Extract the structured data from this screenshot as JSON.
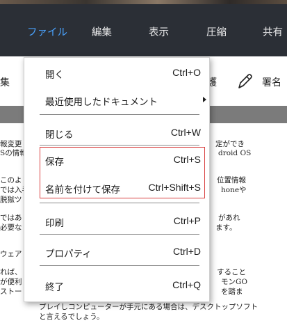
{
  "menubar": {
    "tabs": [
      {
        "label": "ファイル",
        "active": true
      },
      {
        "label": "編集"
      },
      {
        "label": "表示"
      },
      {
        "label": "圧縮"
      },
      {
        "label": "共有"
      }
    ]
  },
  "toolbar": {
    "left_label": "集",
    "protect_label": "護",
    "sign_label": "署名",
    "sign_icon": "pen-icon"
  },
  "menu": {
    "items": [
      {
        "label": "開く",
        "shortcut": "Ctrl+O"
      },
      {
        "label": "最近使用したドキュメント",
        "shortcut": ""
      },
      {
        "label": "閉じる",
        "shortcut": "Ctrl+W"
      },
      {
        "label": "保存",
        "shortcut": "Ctrl+S"
      },
      {
        "label": "名前を付けて保存",
        "shortcut": "Ctrl+Shift+S"
      },
      {
        "label": "印刷",
        "shortcut": "Ctrl+P"
      },
      {
        "label": "プロパティ",
        "shortcut": "Ctrl+D"
      },
      {
        "label": "終了",
        "shortcut": "Ctrl+Q"
      }
    ]
  },
  "document": {
    "lines_left": [
      "報変更",
      "Sの情報",
      "このよ",
      "では入手",
      "脱獄ツ",
      "ではあ",
      "必要な",
      "ウェア",
      "れば、",
      "が便利",
      "ストー"
    ],
    "lines_right": [
      "定ができ",
      "droid OS",
      "位置情報",
      "honeや",
      "があれ",
      "ます。",
      "すること",
      "モンGO",
      "を踏ま"
    ],
    "line_bottom1": "プレイしコンピューターが手元にある場合は、デスクトップソフト",
    "line_bottom2": "と言えるでしょう。"
  },
  "colors": {
    "menubar_bg": "#2b2f36",
    "active_tab": "#4aa3ff",
    "highlight_border": "#d94040"
  }
}
